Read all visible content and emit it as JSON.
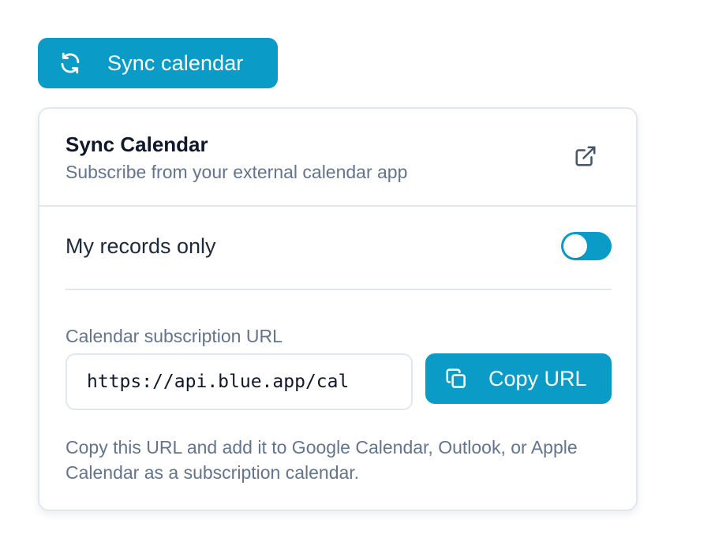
{
  "sync_button": {
    "label": "Sync calendar",
    "icon": "refresh-icon",
    "color": "#0a9cc7"
  },
  "panel": {
    "title": "Sync Calendar",
    "subtitle": "Subscribe from your external calendar app",
    "header_icon": "external-link-icon"
  },
  "toggle": {
    "label": "My records only",
    "state": "on",
    "color": "#0a9cc7"
  },
  "subscription": {
    "label": "Calendar subscription URL",
    "url": "https://api.blue.app/cal",
    "copy_label": "Copy URL",
    "copy_icon": "copy-icon"
  },
  "help_text": "Copy this URL and add it to Google Calendar, Outlook, or Apple Calendar as a subscription calendar."
}
